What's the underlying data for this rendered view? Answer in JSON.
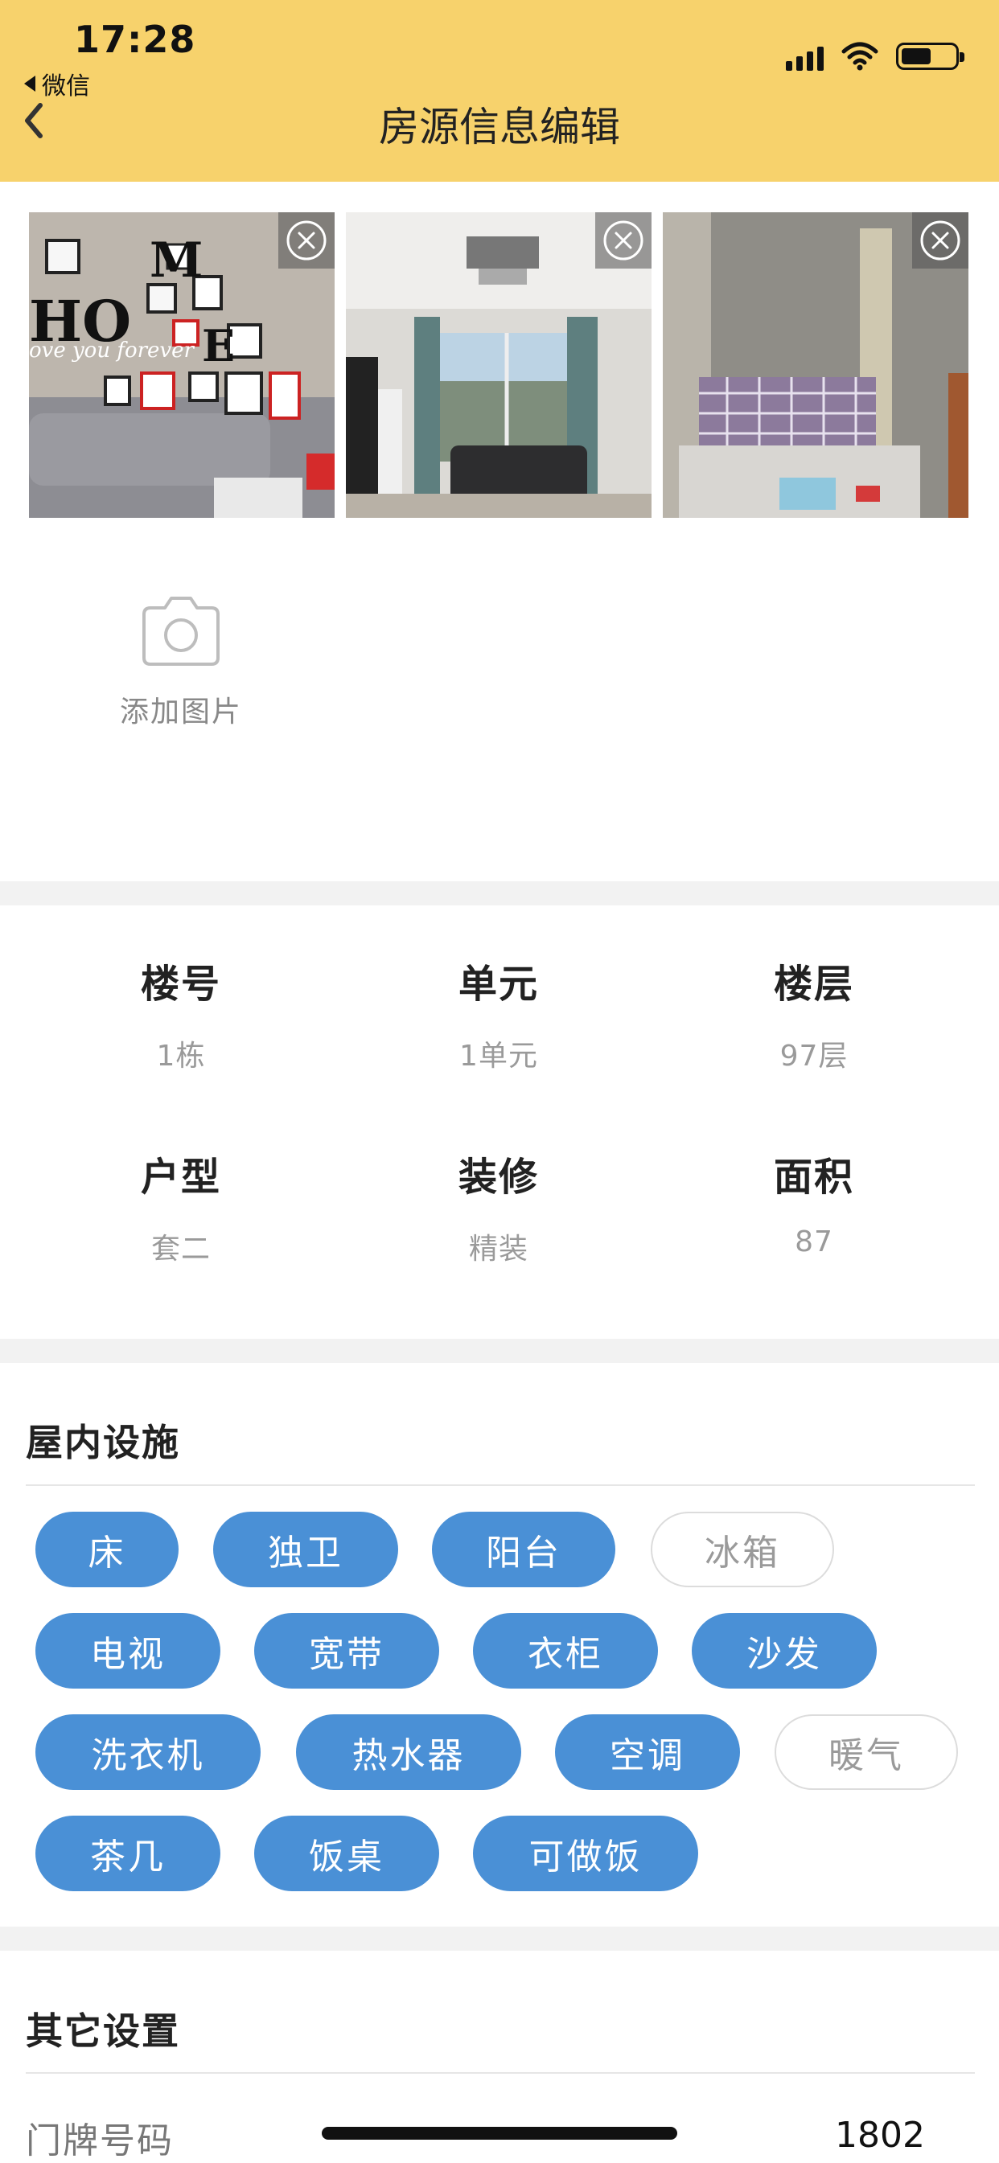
{
  "status_bar": {
    "time": "17:28",
    "back_app": "微信"
  },
  "header": {
    "title": "房源信息编辑"
  },
  "photos": {
    "add_label": "添加图片"
  },
  "info_grid": [
    {
      "key": "楼号",
      "value": "1栋"
    },
    {
      "key": "单元",
      "value": "1单元"
    },
    {
      "key": "楼层",
      "value": "97层"
    },
    {
      "key": "户型",
      "value": "套二"
    },
    {
      "key": "装修",
      "value": "精装"
    },
    {
      "key": "面积",
      "value": "87"
    }
  ],
  "facilities": {
    "title": "屋内设施",
    "items": [
      {
        "label": "床",
        "selected": true
      },
      {
        "label": "独卫",
        "selected": true
      },
      {
        "label": "阳台",
        "selected": true
      },
      {
        "label": "冰箱",
        "selected": false
      },
      {
        "label": "电视",
        "selected": true
      },
      {
        "label": "宽带",
        "selected": true
      },
      {
        "label": "衣柜",
        "selected": true
      },
      {
        "label": "沙发",
        "selected": true
      },
      {
        "label": "洗衣机",
        "selected": true
      },
      {
        "label": "热水器",
        "selected": true
      },
      {
        "label": "空调",
        "selected": true
      },
      {
        "label": "暖气",
        "selected": false
      },
      {
        "label": "茶几",
        "selected": true
      },
      {
        "label": "饭桌",
        "selected": true
      },
      {
        "label": "可做饭",
        "selected": true
      }
    ]
  },
  "other_settings": {
    "title": "其它设置",
    "door_number_label": "门牌号码",
    "door_number_value": "1802"
  },
  "colors": {
    "header_bg": "#f7d26c",
    "chip_active": "#4a90d6"
  }
}
